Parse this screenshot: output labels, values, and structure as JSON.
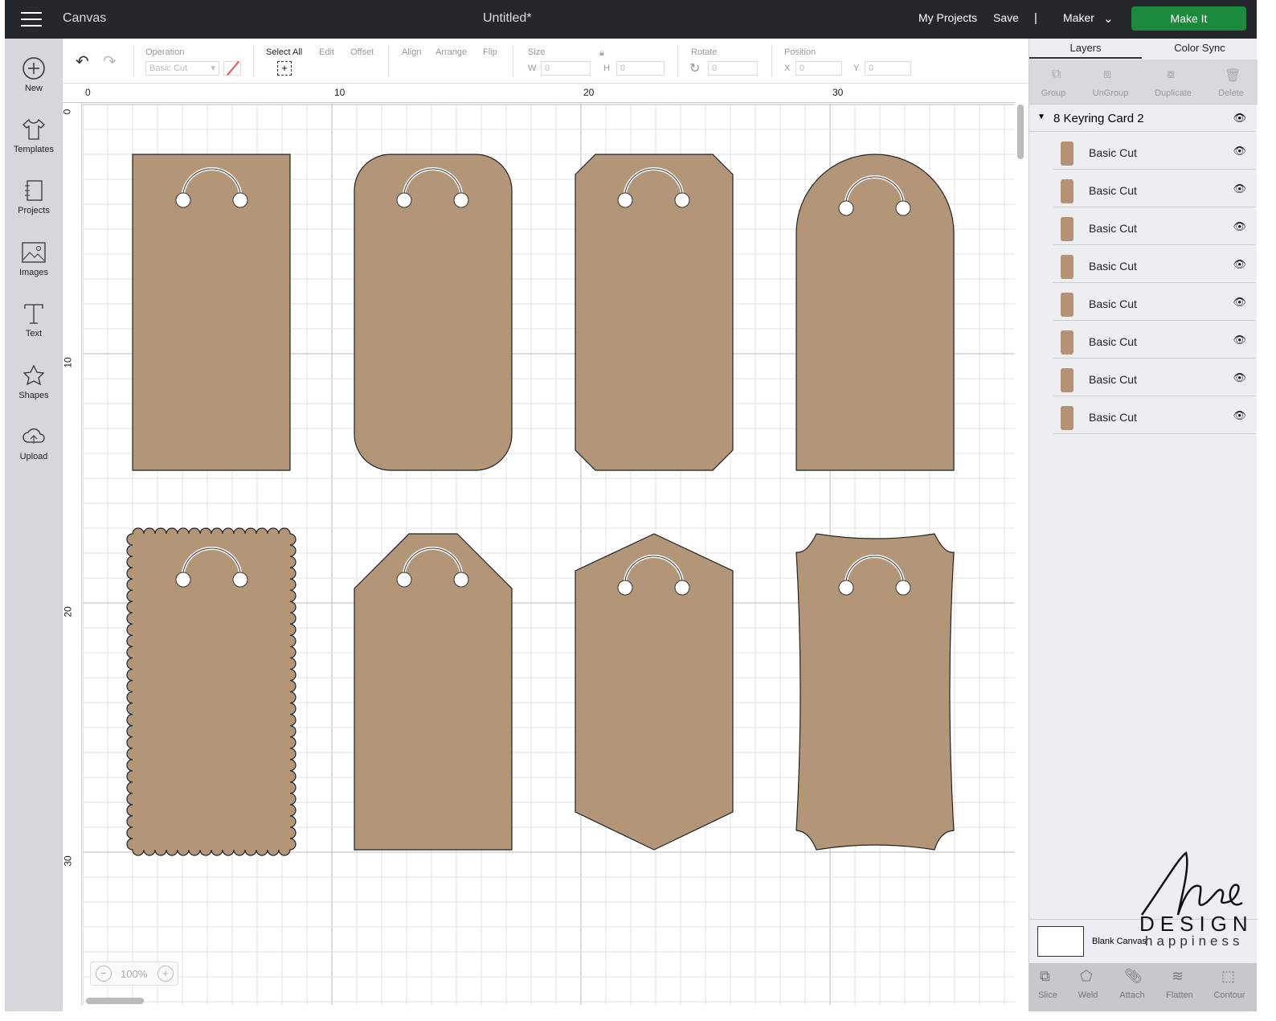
{
  "topbar": {
    "app": "Canvas",
    "title": "Untitled*",
    "my_projects": "My Projects",
    "save": "Save",
    "divider": "|",
    "machine": "Maker",
    "make_it": "Make It"
  },
  "leftnav": [
    {
      "label": "New",
      "icon": "plus-circle-icon"
    },
    {
      "label": "Templates",
      "icon": "tshirt-icon"
    },
    {
      "label": "Projects",
      "icon": "book-icon"
    },
    {
      "label": "Images",
      "icon": "image-icon"
    },
    {
      "label": "Text",
      "icon": "text-icon"
    },
    {
      "label": "Shapes",
      "icon": "shapes-icon"
    },
    {
      "label": "Upload",
      "icon": "cloud-upload-icon"
    }
  ],
  "toolbar": {
    "operation_label": "Operation",
    "operation_value": "Basic Cut",
    "select_all": "Select All",
    "edit": "Edit",
    "offset": "Offset",
    "align": "Align",
    "arrange": "Arrange",
    "flip": "Flip",
    "size": "Size",
    "w_label": "W",
    "w_value": "0",
    "h_label": "H",
    "h_value": "0",
    "rotate": "Rotate",
    "rotate_value": "0",
    "position": "Position",
    "x_label": "X",
    "x_value": "0",
    "y_label": "Y",
    "y_value": "0"
  },
  "ruler": {
    "top": [
      "0",
      "10",
      "20",
      "30"
    ],
    "left": [
      "0",
      "10",
      "20",
      "30"
    ]
  },
  "zoom": {
    "value": "100%"
  },
  "panel": {
    "tabs": [
      "Layers",
      "Color Sync"
    ],
    "actions": [
      "Group",
      "UnGroup",
      "Duplicate",
      "Delete"
    ],
    "group_name": "8 Keyring Card 2",
    "layers": [
      "Basic Cut",
      "Basic Cut",
      "Basic Cut",
      "Basic Cut",
      "Basic Cut",
      "Basic Cut",
      "Basic Cut",
      "Basic Cut"
    ],
    "canvas_label": "Blank Canvas",
    "bottom": [
      "Slice",
      "Weld",
      "Attach",
      "Flatten",
      "Contour"
    ]
  },
  "watermark": {
    "line1": "DESIGN",
    "line2": "happiness"
  },
  "colors": {
    "tag_fill": "#b39677",
    "accent": "#1b8a3c",
    "topbar": "#24272b"
  }
}
